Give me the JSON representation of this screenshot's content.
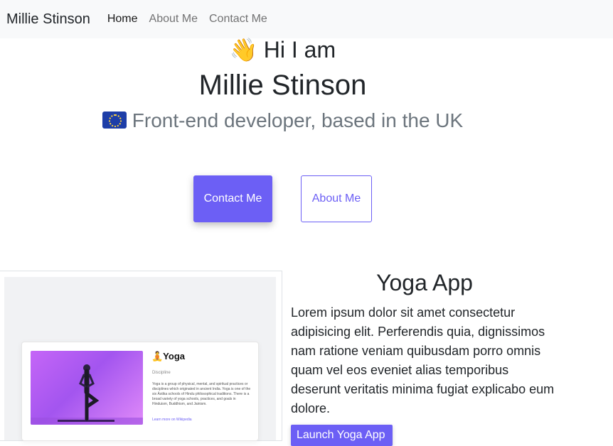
{
  "navbar": {
    "brand": "Millie Stinson",
    "links": [
      {
        "label": "Home",
        "active": true
      },
      {
        "label": "About Me",
        "active": false
      },
      {
        "label": "Contact Me",
        "active": false
      }
    ]
  },
  "hero": {
    "wave_emoji": "👋",
    "greeting": "Hi I am",
    "name": "Millie Stinson",
    "flag_icon": "eu-flag-icon",
    "role": "Front-end developer, based in the UK",
    "contact_button": "Contact Me",
    "about_button": "About Me"
  },
  "project": {
    "title": "Yoga App",
    "description": "Lorem ipsum dolor sit amet consectetur adipisicing elit. Perferendis quia, dignissimos nam ratione veniam quibusdam porro omnis quam vel eos eveniet alias temporibus deserunt veritatis minima fugiat explicabo eum dolore.",
    "launch_button": "Launch Yoga App",
    "screenshot": {
      "card_title": "🧘Yoga",
      "subtitle": "Discipline",
      "text": "Yoga is a group of physical, mental, and spiritual practices or disciplines which originated in ancient India. Yoga is one of the six Āstika schools of Hindu philosophical traditions. There is a broad variety of yoga schools, practices, and goals in Hinduism, Buddhism, and Jainism.",
      "link": "Learn more on Wikipedia"
    }
  },
  "colors": {
    "accent": "#6c5ff5",
    "navbar_bg": "#f8f9fa",
    "muted_text": "#6c757d"
  }
}
